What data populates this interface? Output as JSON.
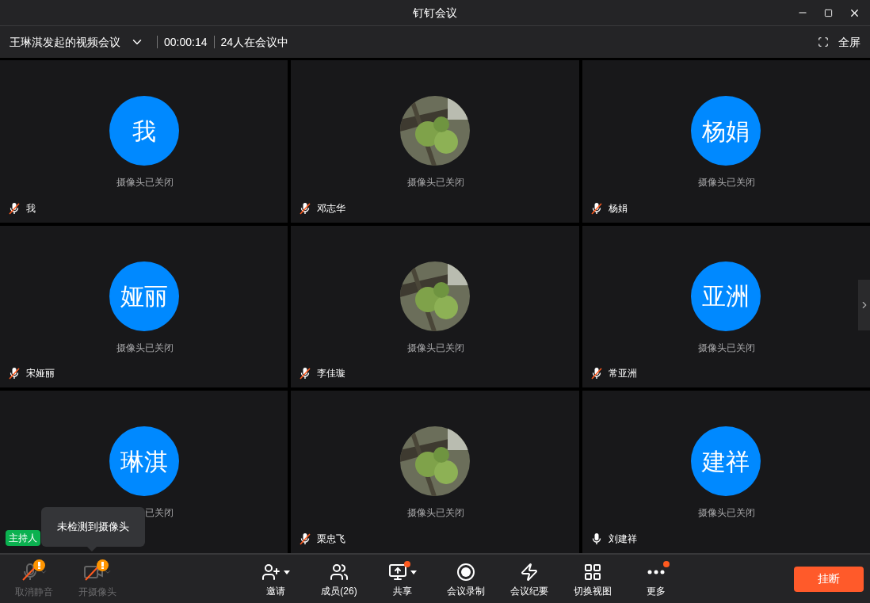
{
  "window": {
    "title": "钉钉会议"
  },
  "meeting": {
    "name": "王琳淇发起的视频会议",
    "timer": "00:00:14",
    "attendance": "24人在会议中",
    "fullscreen": "全屏"
  },
  "tiles": [
    {
      "kind": "initials",
      "avatar_text": "我",
      "status": "摄像头已关闭",
      "name": "我",
      "muted": true
    },
    {
      "kind": "picture",
      "status": "摄像头已关闭",
      "name": "邓志华",
      "muted": true
    },
    {
      "kind": "initials",
      "avatar_text": "杨娟",
      "status": "摄像头已关闭",
      "name": "杨娟",
      "muted": true
    },
    {
      "kind": "initials",
      "avatar_text": "娅丽",
      "status": "摄像头已关闭",
      "name": "宋娅丽",
      "muted": true
    },
    {
      "kind": "picture",
      "status": "摄像头已关闭",
      "name": "李佳璇",
      "muted": true
    },
    {
      "kind": "initials",
      "avatar_text": "亚洲",
      "status": "摄像头已关闭",
      "name": "常亚洲",
      "muted": true
    },
    {
      "kind": "initials",
      "avatar_text": "琳淇",
      "status": "已关闭",
      "host_badge": "主持人"
    },
    {
      "kind": "picture",
      "status": "摄像头已关闭",
      "name": "栗忠飞",
      "muted": true
    },
    {
      "kind": "initials",
      "avatar_text": "建祥",
      "status": "摄像头已关闭",
      "name": "刘建祥",
      "muted": false
    }
  ],
  "tooltip": "未检测到摄像头",
  "toolbar_left": [
    {
      "kind": "mic",
      "label": "取消静音",
      "disabled": true,
      "warning": true
    },
    {
      "kind": "camera",
      "label": "开摄像头",
      "disabled": true,
      "warning": true
    }
  ],
  "toolbar": [
    {
      "kind": "invite",
      "label": "邀请",
      "dropdown": true,
      "dot": false
    },
    {
      "kind": "members",
      "label": "成员(26)",
      "dropdown": false,
      "dot": false
    },
    {
      "kind": "share",
      "label": "共享",
      "dropdown": true,
      "dot": true
    },
    {
      "kind": "record",
      "label": "会议录制",
      "dropdown": false,
      "dot": false
    },
    {
      "kind": "minutes",
      "label": "会议纪要",
      "dropdown": false,
      "dot": false
    },
    {
      "kind": "layout",
      "label": "切换视图",
      "dropdown": false,
      "dot": false
    },
    {
      "kind": "more",
      "label": "更多",
      "dropdown": false,
      "dot": true
    }
  ],
  "hangup": "挂断"
}
